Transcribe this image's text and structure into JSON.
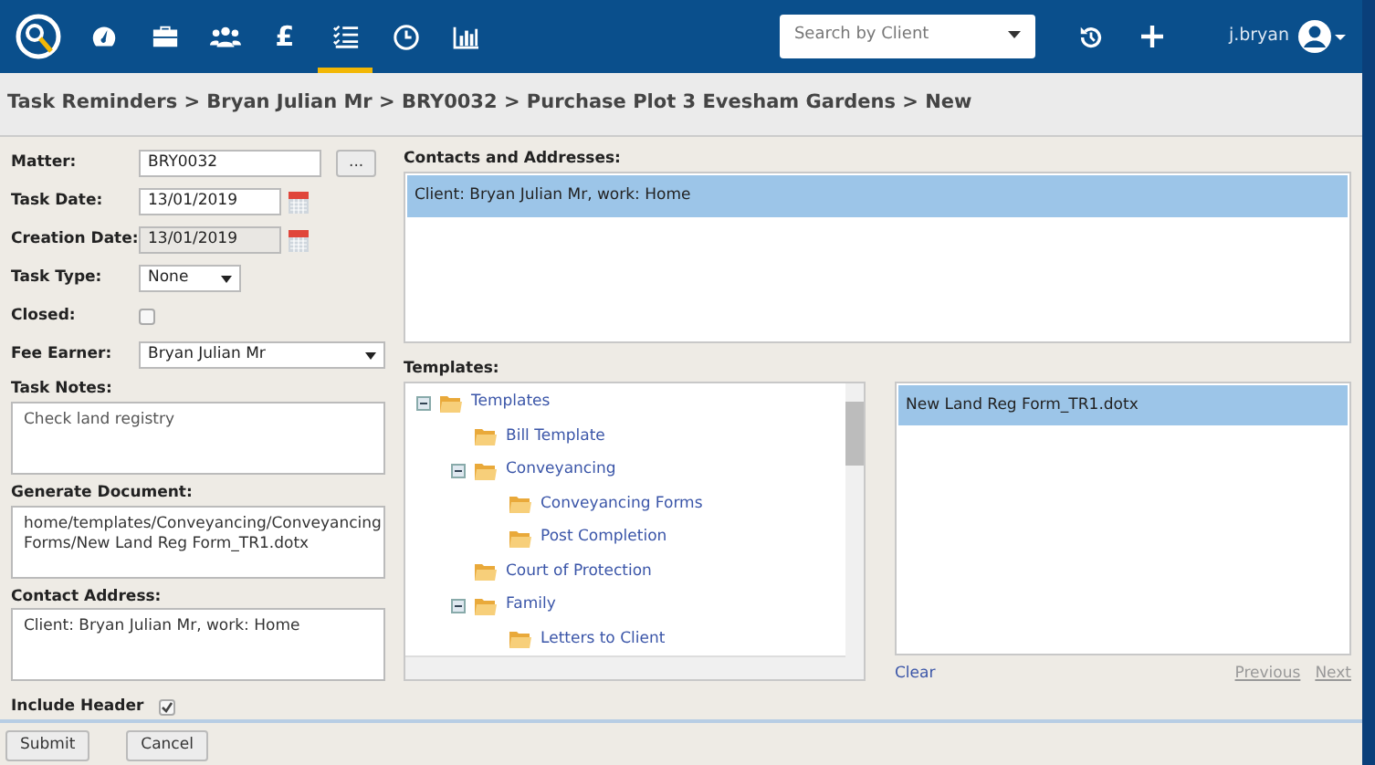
{
  "navbar": {
    "icons": [
      {
        "kind": "gauge",
        "selected": false
      },
      {
        "kind": "briefcase",
        "selected": false
      },
      {
        "kind": "people",
        "selected": false
      },
      {
        "kind": "pound",
        "label": "£",
        "selected": false
      },
      {
        "kind": "tasks",
        "selected": true
      },
      {
        "kind": "clock",
        "selected": false
      },
      {
        "kind": "chart",
        "selected": false
      }
    ],
    "search": {
      "placeholder": "Search by Client"
    },
    "user": "j.bryan"
  },
  "breadcrumb": "Task Reminders > Bryan Julian Mr > BRY0032 > Purchase Plot 3 Evesham Gardens > New",
  "form": {
    "matter": {
      "label": "Matter:",
      "value": "BRY0032",
      "button": "..."
    },
    "task_date": {
      "label": "Task Date:",
      "value": "13/01/2019"
    },
    "creation_date": {
      "label": "Creation Date:",
      "value": "13/01/2019",
      "disabled": true
    },
    "task_type": {
      "label": "Task Type:",
      "value": "None"
    },
    "closed": {
      "label": "Closed:",
      "checked": false
    },
    "fee_earner": {
      "label": "Fee Earner:",
      "value": "Bryan Julian Mr"
    },
    "task_notes": {
      "label": "Task Notes:",
      "value": "Check land registry"
    },
    "generate_document": {
      "label": "Generate Document:",
      "value": "home/templates/Conveyancing/Conveyancing Forms/New Land Reg Form_TR1.dotx"
    },
    "contact_address": {
      "label": "Contact Address:",
      "value": "Client: Bryan Julian Mr, work: Home"
    },
    "include_header": {
      "label": "Include Header",
      "checked": true
    }
  },
  "contacts": {
    "label": "Contacts and Addresses:",
    "items": [
      {
        "text": "Client: Bryan Julian Mr, work: Home",
        "selected": true
      }
    ]
  },
  "templates": {
    "label": "Templates:",
    "tree": [
      {
        "label": "Templates",
        "expanded": true,
        "children": [
          {
            "label": "Bill Template"
          },
          {
            "label": "Conveyancing",
            "expanded": true,
            "children": [
              {
                "label": "Conveyancing Forms"
              },
              {
                "label": "Post Completion"
              }
            ]
          },
          {
            "label": "Court of Protection"
          },
          {
            "label": "Family",
            "expanded": true,
            "children": [
              {
                "label": "Letters to Client"
              }
            ]
          }
        ]
      }
    ],
    "files": [
      {
        "text": "New Land Reg Form_TR1.dotx",
        "selected": true
      }
    ],
    "clear": "Clear",
    "previous": "Previous",
    "next": "Next"
  },
  "buttons": [
    "Submit",
    "Cancel"
  ]
}
